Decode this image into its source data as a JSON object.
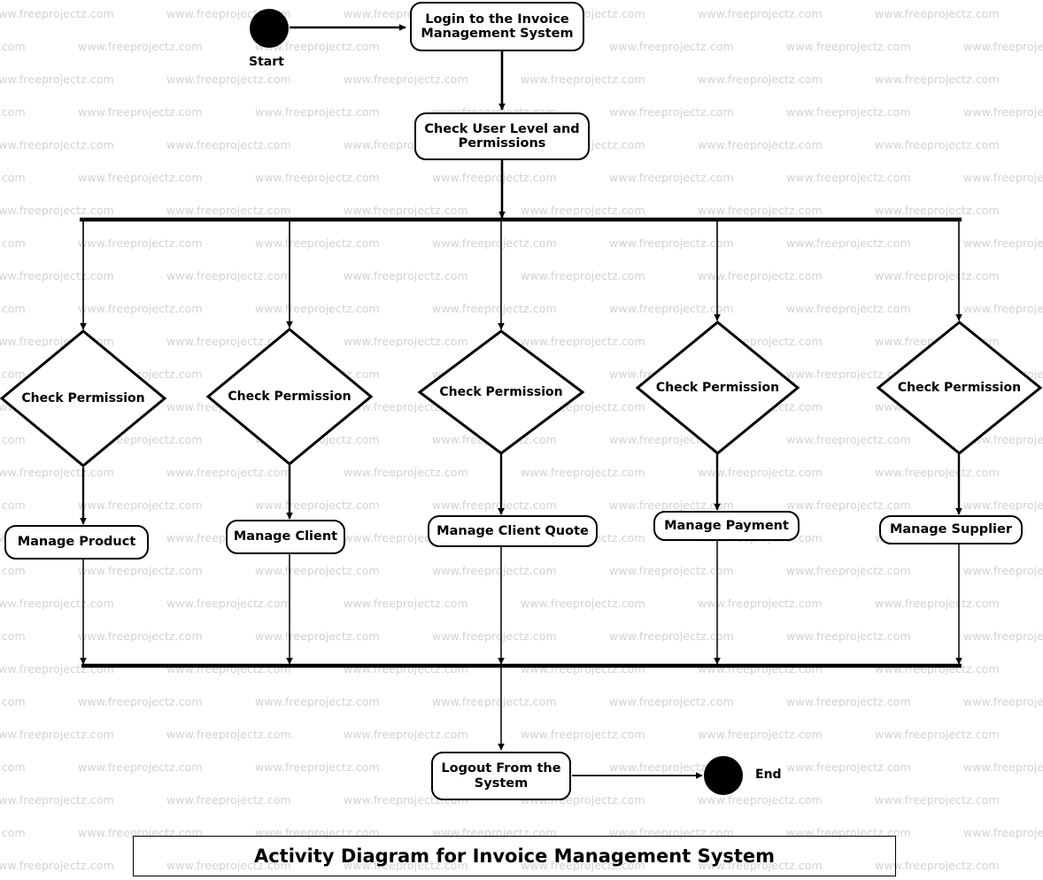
{
  "diagram": {
    "title": "Activity Diagram for Invoice Management System",
    "type": "uml-activity-diagram",
    "watermark_text": "www.freeprojectz.com",
    "colors": {
      "stroke": "#000000",
      "fill": "#ffffff",
      "watermark": "#d2d2d2"
    },
    "start": {
      "label": "Start",
      "shape": "filled-circle"
    },
    "end": {
      "label": "End",
      "shape": "filled-circle"
    },
    "activities": [
      {
        "id": "login",
        "label": "Login to the Invoice Management System"
      },
      {
        "id": "check_user",
        "label": "Check User Level and Permissions"
      },
      {
        "id": "manage_product",
        "label": "Manage Product"
      },
      {
        "id": "manage_client",
        "label": "Manage Client"
      },
      {
        "id": "manage_quote",
        "label": "Manage Client Quote"
      },
      {
        "id": "manage_payment",
        "label": "Manage Payment"
      },
      {
        "id": "manage_supplier",
        "label": "Manage Supplier"
      },
      {
        "id": "logout",
        "label": "Logout From the System"
      }
    ],
    "decisions": [
      {
        "id": "dec_product",
        "label": "Check Permission"
      },
      {
        "id": "dec_client",
        "label": "Check Permission"
      },
      {
        "id": "dec_quote",
        "label": "Check Permission"
      },
      {
        "id": "dec_payment",
        "label": "Check Permission"
      },
      {
        "id": "dec_supplier",
        "label": "Check Permission"
      }
    ],
    "bars": [
      {
        "id": "fork",
        "type": "fork"
      },
      {
        "id": "join",
        "type": "join"
      }
    ]
  }
}
